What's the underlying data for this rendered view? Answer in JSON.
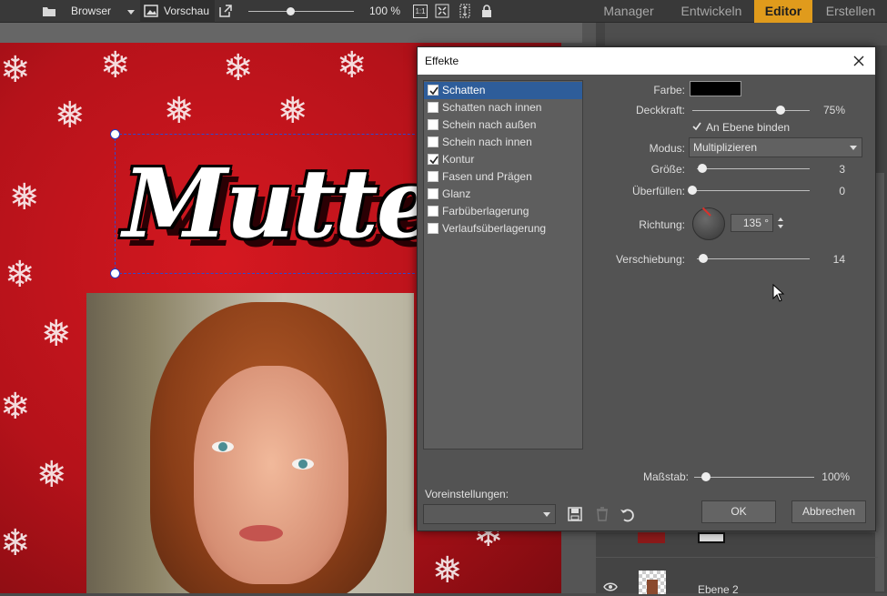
{
  "toolbar": {
    "browser_label": "Browser",
    "preview_label": "Vorschau",
    "zoom": "100 %",
    "one_to_one": "1:1",
    "zoom_slider_fraction": 0.4
  },
  "modes": [
    {
      "label": "Manager",
      "active": false
    },
    {
      "label": "Entwickeln",
      "active": false
    },
    {
      "label": "Editor",
      "active": true
    },
    {
      "label": "Erstellen",
      "active": false
    }
  ],
  "canvas": {
    "title_text": "Mutte"
  },
  "layers": {
    "layer2_name": "Ebene 2"
  },
  "dialog": {
    "title": "Effekte",
    "effects": [
      {
        "label": "Schatten",
        "checked": true,
        "selected": true
      },
      {
        "label": "Schatten nach innen",
        "checked": false,
        "selected": false
      },
      {
        "label": "Schein nach außen",
        "checked": false,
        "selected": false
      },
      {
        "label": "Schein nach innen",
        "checked": false,
        "selected": false
      },
      {
        "label": "Kontur",
        "checked": true,
        "selected": false
      },
      {
        "label": "Fasen und Prägen",
        "checked": false,
        "selected": false
      },
      {
        "label": "Glanz",
        "checked": false,
        "selected": false
      },
      {
        "label": "Farbüberlagerung",
        "checked": false,
        "selected": false
      },
      {
        "label": "Verlaufsüberlagerung",
        "checked": false,
        "selected": false
      }
    ],
    "props": {
      "color_label": "Farbe:",
      "color_value": "#000000",
      "opacity_label": "Deckkraft:",
      "opacity_value": "75%",
      "opacity_fraction": 0.75,
      "bind_label": "An Ebene binden",
      "bind_checked": true,
      "mode_label": "Modus:",
      "mode_value": "Multiplizieren",
      "size_label": "Größe:",
      "size_value": "3",
      "size_fraction": 0.05,
      "spread_label": "Überfüllen:",
      "spread_value": "0",
      "spread_fraction": 0.0,
      "direction_label": "Richtung:",
      "direction_value": "135 °",
      "offset_label": "Verschiebung:",
      "offset_value": "14",
      "offset_fraction": 0.06,
      "scale_label": "Maßstab:",
      "scale_value": "100%",
      "scale_fraction": 0.1
    },
    "presets_label": "Voreinstellungen:",
    "ok_label": "OK",
    "cancel_label": "Abbrechen"
  },
  "colors": {
    "accent": "#e09b1c",
    "selection": "#2e5d9a",
    "canvas_red": "#c4141c"
  }
}
